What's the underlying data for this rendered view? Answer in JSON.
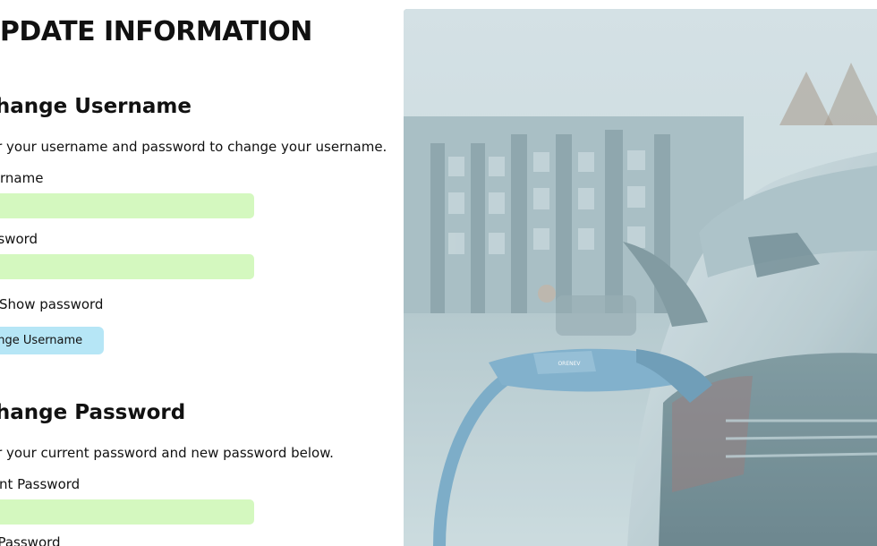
{
  "page_title": "UPDATE INFORMATION",
  "change_username": {
    "title": "Change Username",
    "description": "Enter your username and password to change your username.",
    "username_label": "Username",
    "username_value": "",
    "password_label": "Password",
    "password_value": "",
    "show_password_label": "Show password",
    "show_password_checked": false,
    "submit_label": "Change Username"
  },
  "change_password": {
    "title": "Change Password",
    "description": "Enter your current password and new password below.",
    "current_password_label": "Current Password",
    "current_password_value": "",
    "new_password_label": "New Password"
  },
  "image": {
    "subject": "electric car charging photo",
    "connector_brand": "ORENEV"
  },
  "colors": {
    "input_bg": "#d4f8bf",
    "button_bg": "#b6e6f6",
    "image_tint": "#bfd3d8"
  }
}
